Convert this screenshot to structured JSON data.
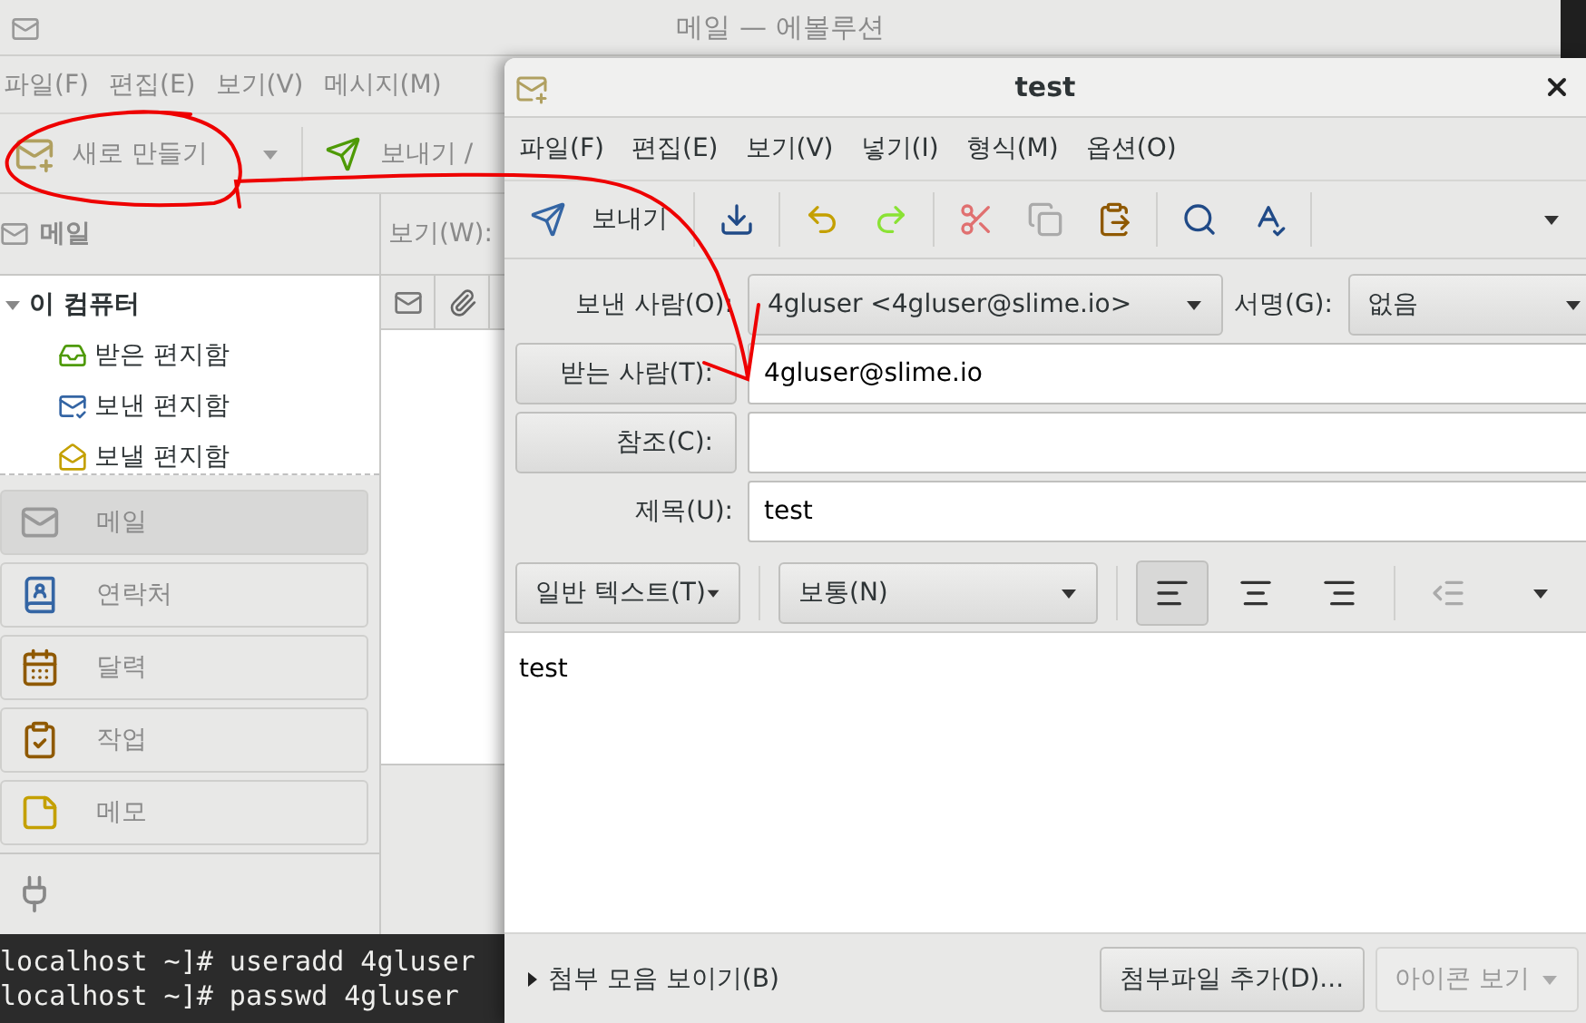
{
  "main_window": {
    "title": "메일 — 에볼루션",
    "menu": [
      "파일(F)",
      "편집(E)",
      "보기(V)",
      "메시지(M)"
    ],
    "toolbar": [
      {
        "label": "새로 만들기",
        "kind": "new"
      },
      {
        "label": "보내기 /",
        "kind": "send"
      }
    ],
    "sidebar": {
      "header": "메일",
      "tree": [
        {
          "label": "이 컴퓨터",
          "expanded": true,
          "children": [
            {
              "label": "받은 편지함",
              "kind": "inbox"
            },
            {
              "label": "보낸 편지함",
              "kind": "sent"
            },
            {
              "label": "보낼 편지함",
              "kind": "outbox"
            }
          ]
        }
      ],
      "switcher": [
        {
          "label": "메일",
          "kind": "mail",
          "selected": true
        },
        {
          "label": "연락처",
          "kind": "contacts",
          "selected": false
        },
        {
          "label": "달력",
          "kind": "calendar",
          "selected": false
        },
        {
          "label": "작업",
          "kind": "tasks",
          "selected": false
        },
        {
          "label": "메모",
          "kind": "memos",
          "selected": false
        }
      ]
    },
    "view_label": "보기(W):"
  },
  "terminal": {
    "lines": [
      "localhost ~]# useradd 4gluser",
      "localhost ~]# passwd 4gluser"
    ]
  },
  "compose": {
    "title": "test",
    "menu": [
      "파일(F)",
      "편집(E)",
      "보기(V)",
      "넣기(I)",
      "형식(M)",
      "옵션(O)"
    ],
    "send_button": "보내기",
    "from": {
      "label": "보낸 사람(O):",
      "value": "4gluser <4gluser@slime.io>"
    },
    "signature": {
      "label": "서명(G):",
      "value": "없음"
    },
    "to": {
      "label": "받는 사람(T):",
      "value": "4gluser@slime.io"
    },
    "cc": {
      "label": "참조(C):"
    },
    "subject": {
      "label": "제목(U):",
      "value": "test"
    },
    "format": {
      "mode": "일반 텍스트(T)",
      "paragraph": "보통(N)",
      "alignment": [
        {
          "kind": "left",
          "selected": true
        },
        {
          "kind": "center",
          "selected": false
        },
        {
          "kind": "right",
          "selected": false
        }
      ]
    },
    "body": "test",
    "attachment_bar": {
      "toggle": "첨부 모음 보이기(B)",
      "expanded": false,
      "add_button": "첨부파일 추가(D)...",
      "view_button": {
        "label": "아이콘 보기",
        "disabled": true
      }
    }
  }
}
